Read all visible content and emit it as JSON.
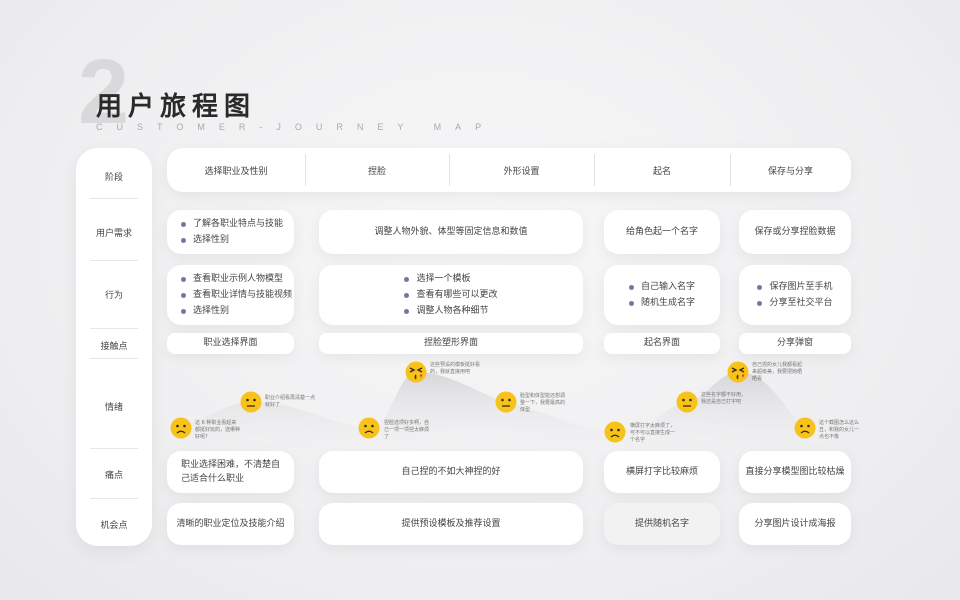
{
  "header": {
    "number": "2",
    "title": "用户旅程图",
    "subtitle": "CUSTOMER-JOURNEY MAP"
  },
  "rows": [
    "阶段",
    "用户需求",
    "行为",
    "接触点",
    "情绪",
    "痛点",
    "机会点"
  ],
  "stages": [
    "选择职业及性别",
    "捏脸",
    "外形设置",
    "起名",
    "保存与分享"
  ],
  "needs": {
    "col1": [
      "了解各职业特点与技能",
      "选择性别"
    ],
    "col2": "调整人物外貌、体型等固定信息和数值",
    "col3": "给角色起一个名字",
    "col4": "保存或分享捏脸数据"
  },
  "actions": {
    "col1": [
      "查看职业示例人物模型",
      "查看职业详情与技能视频",
      "选择性别"
    ],
    "col2": [
      "选择一个模板",
      "查看有哪些可以更改",
      "调整人物各种细节"
    ],
    "col3": [
      "自己输入名字",
      "随机生成名字"
    ],
    "col4": [
      "保存图片至手机",
      "分享至社交平台"
    ]
  },
  "touchpoints": [
    "职业选择界面",
    "捏脸塑形界面",
    "起名界面",
    "分享弹窗"
  ],
  "emotions": [
    {
      "type": "sad",
      "note": "这 6 种职业看起来都挺好玩的，选哪种好呢?"
    },
    {
      "type": "neutral",
      "note": "职业介绍看再清楚一点就好了"
    },
    {
      "type": "sad",
      "note": "捏脸选项好多啊，自己一项一项捏太麻烦了"
    },
    {
      "type": "kiss",
      "note": "这些预设的模板挺好看的，我就直接用吧"
    },
    {
      "type": "neutral",
      "note": "脸型和体型能还想调整一下，我要最高的体型"
    },
    {
      "type": "sad",
      "note": "横屏打字太麻烦了，可不可以直接生成一个名字"
    },
    {
      "type": "neutral",
      "note": "这些名字都不好用，我还是自己打字吧"
    },
    {
      "type": "kiss",
      "note": "自己捏的女儿我都看起来超级美，我要把她晒晒看"
    },
    {
      "type": "sad",
      "note": "这个截图怎么这么丑，和我的女儿一点也不像"
    }
  ],
  "pains": [
    "职业选择困难，不清楚自己适合什么职业",
    "自己捏的不如大神捏的好",
    "横屏打字比较麻烦",
    "直接分享模型图比较枯燥"
  ],
  "opportunities": [
    "清晰的职业定位及技能介绍",
    "提供预设模板及推荐设置",
    "提供随机名字",
    "分享图片设计成海报"
  ],
  "colors": {
    "face": "#f7c21a",
    "curve": "#d9d9dc",
    "bullet": "#6f7aa0"
  }
}
